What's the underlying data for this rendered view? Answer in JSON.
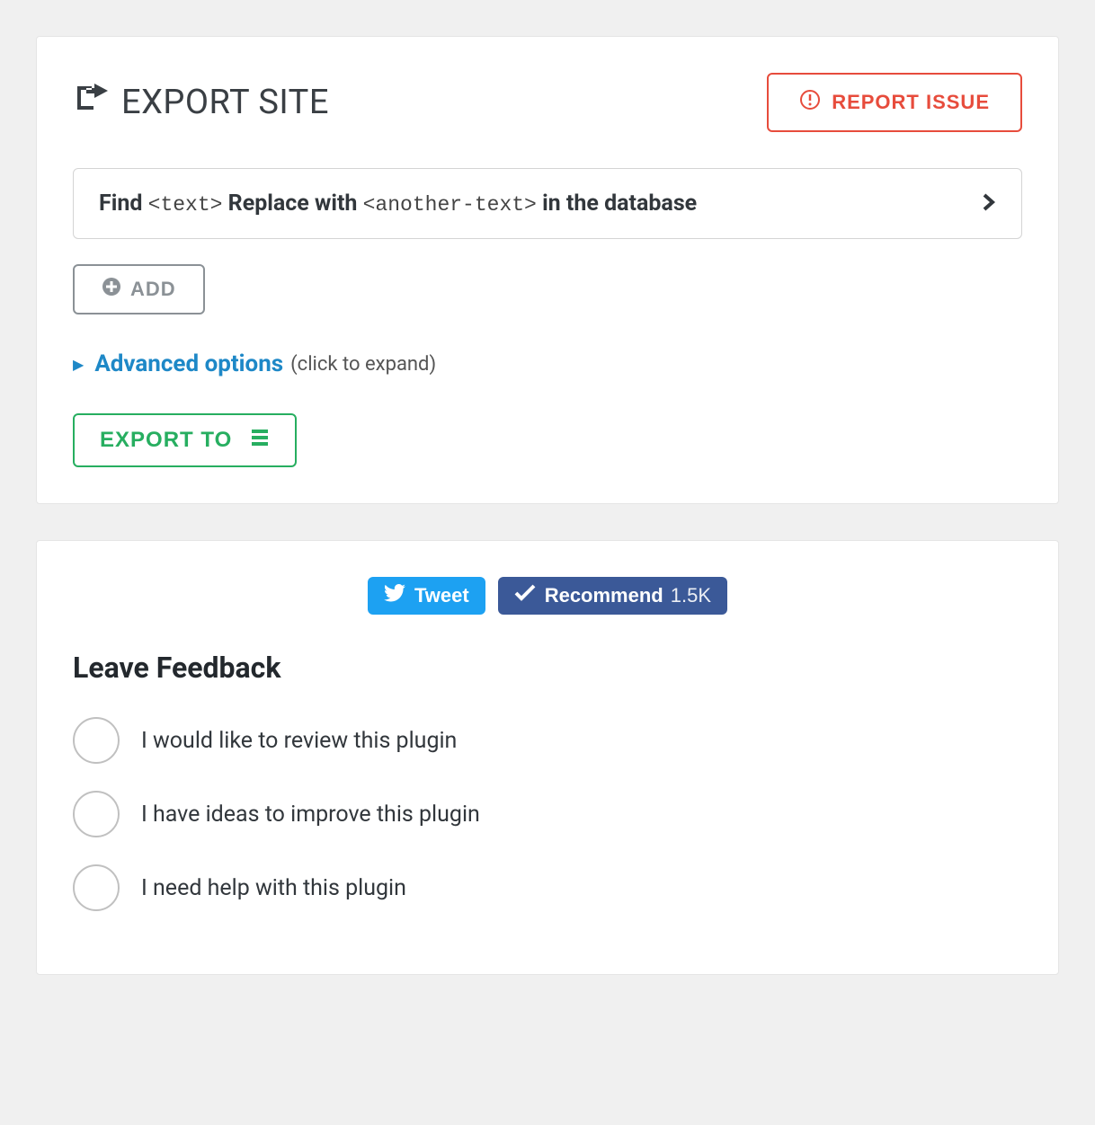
{
  "export": {
    "title": "EXPORT SITE",
    "report_label": "REPORT ISSUE",
    "replace": {
      "find_label": "Find",
      "find_placeholder": "<text>",
      "replace_label": "Replace with",
      "replace_placeholder": "<another-text>",
      "suffix": "in the database"
    },
    "add_label": "ADD",
    "advanced": {
      "link": "Advanced options",
      "hint": "(click to expand)"
    },
    "export_label": "EXPORT TO"
  },
  "social": {
    "tweet_label": "Tweet",
    "recommend_label": "Recommend",
    "recommend_count": "1.5K"
  },
  "feedback": {
    "title": "Leave Feedback",
    "options": [
      "I would like to review this plugin",
      "I have ideas to improve this plugin",
      "I need help with this plugin"
    ]
  }
}
